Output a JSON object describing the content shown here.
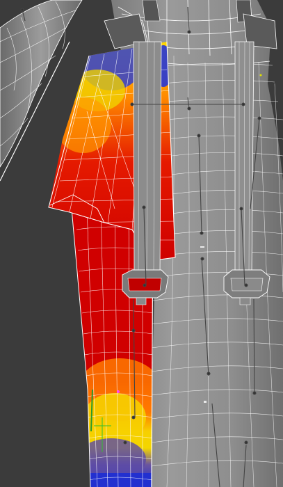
{
  "viewport": {
    "mode": "3d-viewport-skin-weight-paint",
    "background": "#3b3b3b",
    "wire_color": "#ffffff",
    "mesh_color": "#8a8a8a",
    "bone_color": "#555555",
    "weight_colors": {
      "zero": "#1f2fd8",
      "low": "#f3d200",
      "mid": "#ff7a00",
      "high": "#d40000"
    }
  }
}
